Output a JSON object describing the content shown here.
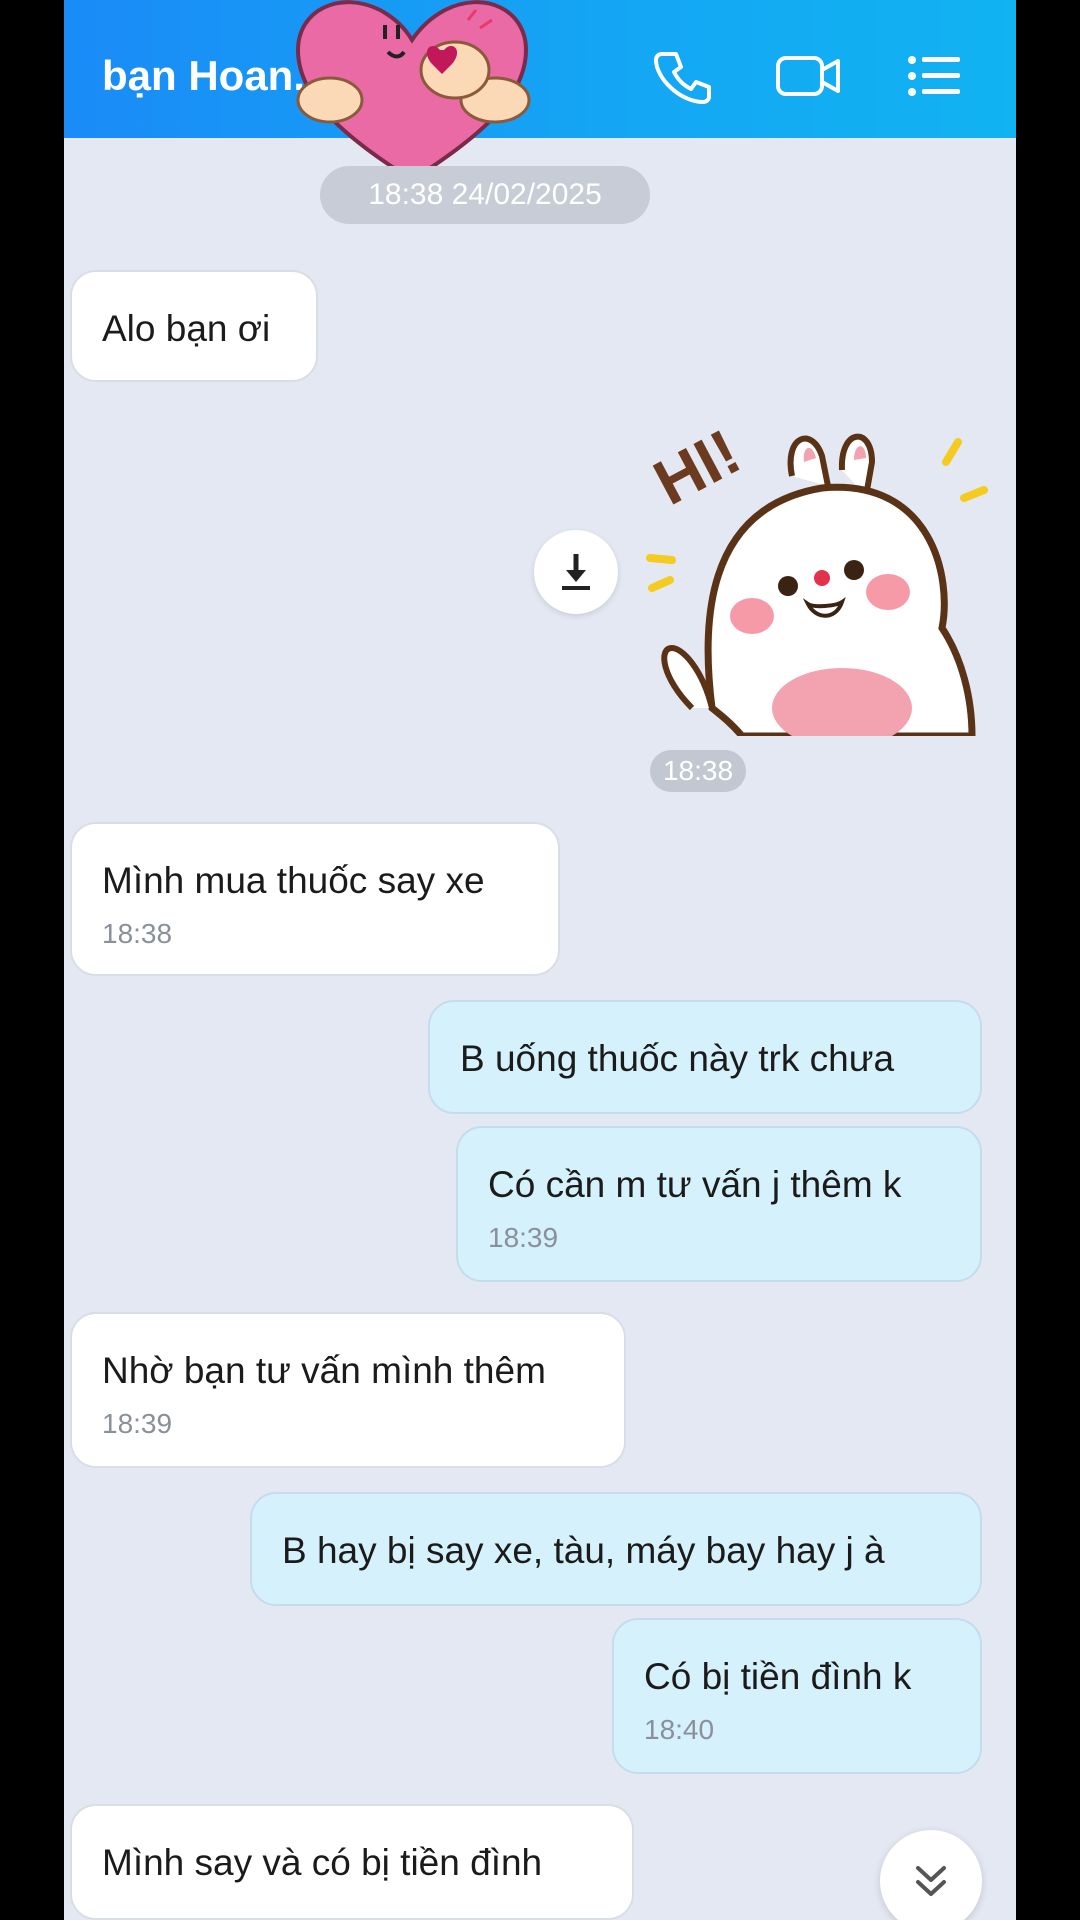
{
  "header": {
    "contact_name": "bạn Hoan...",
    "call_icon": "phone-icon",
    "video_icon": "video-icon",
    "menu_icon": "list-menu-icon",
    "accent": "#1a8bf7"
  },
  "date_separator": "18:38 24/02/2025",
  "sticker_time": "18:38",
  "messages": [
    {
      "dir": "in",
      "text": "Alo bạn ơi",
      "time": ""
    },
    {
      "dir": "in",
      "text": "Mình mua thuốc say xe",
      "time": "18:38"
    },
    {
      "dir": "out",
      "text": "B uống thuốc này trk chưa",
      "time": ""
    },
    {
      "dir": "out",
      "text": "Có cần m tư vấn j thêm k",
      "time": "18:39"
    },
    {
      "dir": "in",
      "text": "Nhờ bạn tư vấn mình thêm",
      "time": "18:39"
    },
    {
      "dir": "out",
      "text": "B hay bị say xe, tàu, máy bay hay j à",
      "time": ""
    },
    {
      "dir": "out",
      "text": "Có bị tiền đình k",
      "time": "18:40"
    },
    {
      "dir": "in",
      "text": "Mình say và có bị tiền đình",
      "time": ""
    }
  ],
  "sticker_text": "HI!"
}
